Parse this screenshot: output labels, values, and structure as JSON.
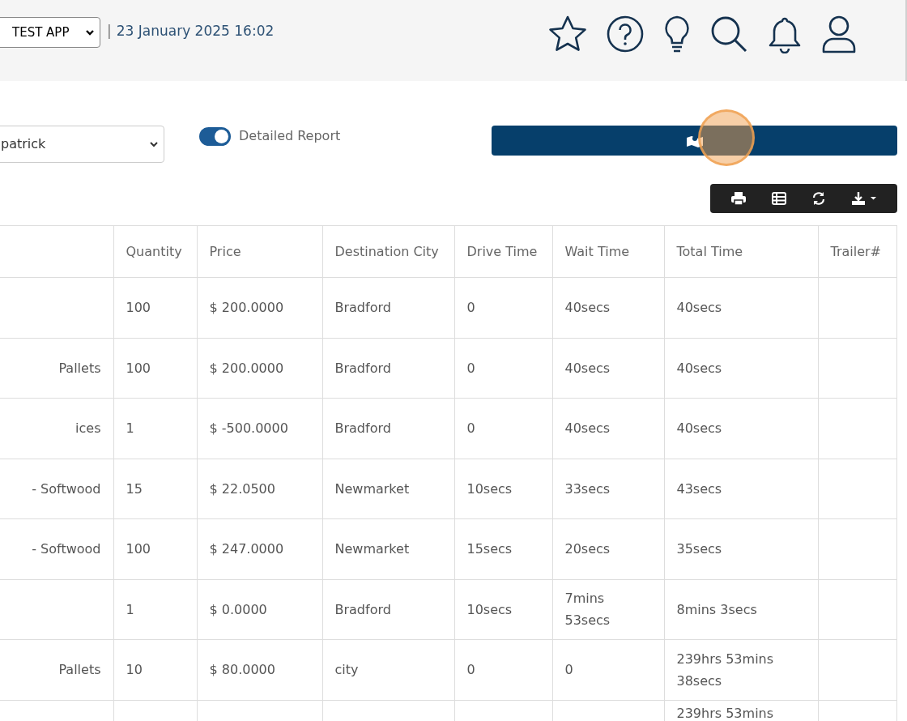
{
  "header": {
    "app_select": {
      "value": "TEST APP"
    },
    "separator": "|",
    "datetime": "23 January 2025 16:02"
  },
  "filters": {
    "user_select": {
      "value": "patrick"
    },
    "detailed_report": {
      "label": "Detailed Report",
      "on": true
    }
  },
  "table": {
    "columns": [
      "",
      "Quantity",
      "Price",
      "Destination City",
      "Drive Time",
      "Wait Time",
      "Total Time",
      "Trailer#"
    ],
    "rows": [
      [
        "",
        "100",
        "$ 200.0000",
        "Bradford",
        "0",
        "40secs",
        "40secs",
        ""
      ],
      [
        "Pallets",
        "100",
        "$ 200.0000",
        "Bradford",
        "0",
        "40secs",
        "40secs",
        ""
      ],
      [
        "ices",
        "1",
        "$ -500.0000",
        "Bradford",
        "0",
        "40secs",
        "40secs",
        ""
      ],
      [
        "- Softwood",
        "15",
        "$ 22.0500",
        "Newmarket",
        "10secs",
        "33secs",
        "43secs",
        ""
      ],
      [
        "- Softwood",
        "100",
        "$ 247.0000",
        "Newmarket",
        "15secs",
        "20secs",
        "35secs",
        ""
      ],
      [
        "",
        "1",
        "$ 0.0000",
        "Bradford",
        "10secs",
        "7mins 53secs",
        "8mins 3secs",
        ""
      ],
      [
        "Pallets",
        "10",
        "$ 80.0000",
        "city",
        "0",
        "0",
        "239hrs 53mins 38secs",
        ""
      ],
      [
        "",
        "",
        "",
        "",
        "",
        "",
        "239hrs 53mins",
        ""
      ]
    ]
  }
}
